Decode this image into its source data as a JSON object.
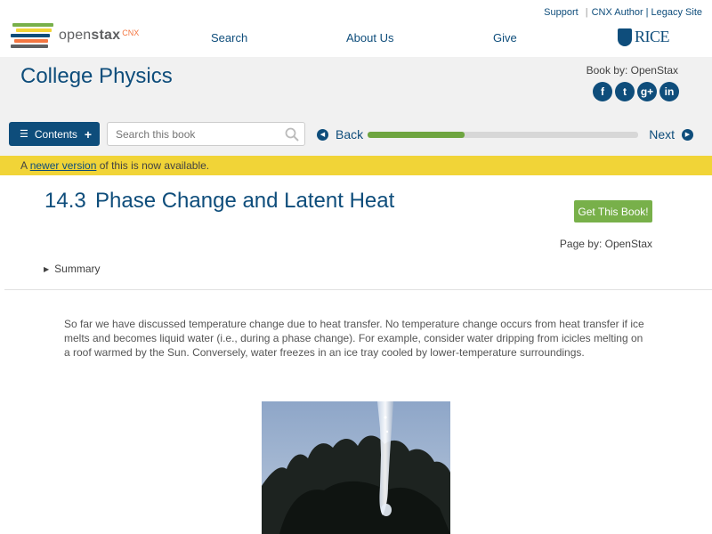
{
  "brand": {
    "name_open": "open",
    "name_stax": "stax",
    "cnx": "CNX",
    "colors": [
      "#f47641",
      "#78b04a",
      "#f1d437",
      "#0e4d7b",
      "#5f6062"
    ]
  },
  "util_links": {
    "support": "Support",
    "cnx_author": "CNX Author",
    "legacy_site": "Legacy Site"
  },
  "nav": {
    "search": "Search",
    "about_us": "About Us",
    "give": "Give",
    "rice": "RICE"
  },
  "book": {
    "title": "College Physics",
    "book_by": "Book by: OpenStax",
    "social": [
      {
        "icon": "facebook-icon",
        "glyph": "f"
      },
      {
        "icon": "twitter-icon",
        "glyph": "t"
      },
      {
        "icon": "google-plus-icon",
        "glyph": "g+"
      },
      {
        "icon": "linkedin-icon",
        "glyph": "in"
      }
    ]
  },
  "toolbar": {
    "contents_label": "Contents",
    "search_placeholder": "Search this book",
    "back_label": "Back",
    "next_label": "Next",
    "progress_fraction": 0.36
  },
  "notice": {
    "prefix": "A ",
    "link": "newer version",
    "suffix": " of this is now available."
  },
  "section": {
    "number": "14.3",
    "title": "Phase Change and Latent Heat",
    "get_book_label": "Get This Book!",
    "page_by": "Page by: OpenStax",
    "summary_label": "Summary",
    "paragraph": "So far we have discussed temperature change due to heat transfer. No temperature change occurs from heat transfer if ice melts and becomes liquid water (i.e., during a phase change). For example, consider water dripping from icicles melting on a roof warmed by the Sun. Conversely, water freezes in an ice tray cooled by lower-temperature surroundings."
  }
}
